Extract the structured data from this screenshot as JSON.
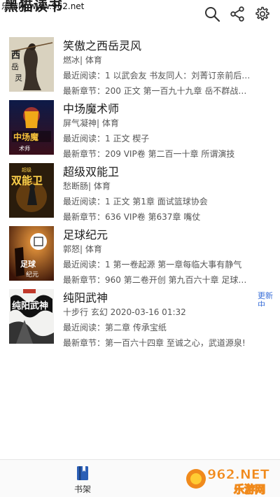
{
  "watermark": {
    "site": "乐游网 www.962.net"
  },
  "header": {
    "title": "黑猫读书"
  },
  "books": [
    {
      "title": "笑傲之西岳灵风",
      "author": "燃冰| 体育",
      "recent": "最近阅读：1 以武会友 书友同人：刘菁订亲前后那些...",
      "latest": "最新章节：200 正文 第一百九十九章 岳不群战左冷..."
    },
    {
      "title": "中场魔术师",
      "author": "屏气凝神| 体育",
      "recent": "最近阅读：1 正文 楔子",
      "latest": "最新章节：209 VIP卷 第二百一十章 所谓演技"
    },
    {
      "title": "超级双能卫",
      "author": "愁断肠| 体育",
      "recent": "最近阅读：1 正文 第1章 面试篮球协会",
      "latest": "最新章节：636 VIP卷 第637章 嘴仗"
    },
    {
      "title": "足球纪元",
      "author": "郭怒| 体育",
      "recent": "最近阅读：1 第一卷起源 第一章每临大事有静气",
      "latest": "最新章节：960 第二卷开创 第九百六十章 足球的纪..."
    },
    {
      "title": "纯阳武神",
      "author": "十步行 玄幻 2020-03-16 01:32",
      "recent": "最近阅读：第二章 传承宝纸",
      "latest": "最新章节：第一百六十四章 至诚之心，武道源泉!",
      "badge": "更新中"
    }
  ],
  "covers": [
    {
      "text": "西岳灵风",
      "colors": [
        "#d8cfb8",
        "#3a2f24"
      ]
    },
    {
      "text": "中场魔术师",
      "colors": [
        "#1a2a5a",
        "#e8b020"
      ]
    },
    {
      "text": "双能卫",
      "colors": [
        "#3a2a10",
        "#f0c040"
      ]
    },
    {
      "text": "足球纪元",
      "colors": [
        "#5a2a10",
        "#ffffff"
      ]
    },
    {
      "text": "纯阳武神",
      "colors": [
        "#eeeeee",
        "#111111"
      ]
    }
  ],
  "bottom_nav": {
    "shelf_label": "书架"
  },
  "logo": {
    "text": "962.NET",
    "subtext": "乐游网"
  },
  "theme": {
    "accent": "#3a6fd8",
    "text": "#1c1c1c",
    "muted": "#555555"
  }
}
